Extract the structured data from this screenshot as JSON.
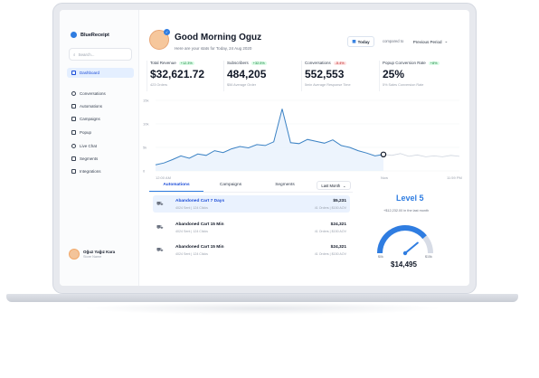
{
  "sidebar": {
    "brand": "BlueReceipt",
    "search_placeholder": "Search...",
    "items": [
      {
        "label": "Dashboard",
        "active": true
      },
      {
        "label": "Conversations"
      },
      {
        "label": "Automations"
      },
      {
        "label": "Campaigns"
      },
      {
        "label": "Popup"
      },
      {
        "label": "Live Chat"
      },
      {
        "label": "Segments"
      },
      {
        "label": "Integrations"
      }
    ],
    "user": {
      "name": "Oğuz Yağız Kara",
      "role": "Store Name"
    }
  },
  "header": {
    "greeting": "Good Morning Oguz",
    "subtitle": "Here are your stats for Today, 24 Aug 2020",
    "date_button": "Today",
    "compared_label": "compared to",
    "period_button": "Previous Period"
  },
  "stats": [
    {
      "label": "Total Revenue",
      "change": "+12.3%",
      "direction": "up",
      "value": "$32,621.72",
      "sub": "423 Orders"
    },
    {
      "label": "Subscribers",
      "change": "+32.5%",
      "direction": "up",
      "value": "484,205",
      "sub": "$56 Average Order"
    },
    {
      "label": "Conversations",
      "change": "-5.4%",
      "direction": "down",
      "value": "552,553",
      "sub": "5min Average Response Time"
    },
    {
      "label": "Popup Conversion Rate",
      "change": "+8%",
      "direction": "up",
      "value": "25%",
      "sub": "5% Sales Conversion Rate"
    }
  ],
  "chart_data": {
    "type": "line",
    "y_ticks": [
      "15k",
      "10k",
      "5k",
      "0"
    ],
    "ylim": [
      0,
      15000
    ],
    "x_labels": [
      "12:00 AM",
      "Now",
      "11:59 PM"
    ],
    "series": [
      {
        "style": "solid",
        "values": [
          1300,
          1700,
          2400,
          3200,
          2700,
          3600,
          3300,
          4300,
          3900,
          4700,
          5200,
          4900,
          5600,
          5400,
          6200,
          13200,
          6000,
          5800,
          6700,
          6300,
          5900,
          6600,
          5400,
          5000,
          4300,
          3800,
          3200,
          3500
        ]
      },
      {
        "style": "dashed",
        "values": [
          3500,
          3300,
          3700,
          3100,
          3400,
          3000,
          3200,
          3000,
          3300,
          3100
        ]
      }
    ]
  },
  "table": {
    "tabs": [
      "Automations",
      "Campaigns",
      "Segments"
    ],
    "filter": "Last Month",
    "rows": [
      {
        "title": "Abandoned Cart 7 Days",
        "sub": "4024 Sent | 124 Clicks",
        "value": "$5,231",
        "sub2": "41 Orders | $150 AOV",
        "highlight": true
      },
      {
        "title": "Abandoned Cart 15 Min",
        "sub": "4024 Sent | 124 Clicks",
        "value": "$24,321",
        "sub2": "41 Orders | $150 AOV"
      },
      {
        "title": "Abandoned Cart 15 Min",
        "sub": "4024 Sent | 124 Clicks",
        "value": "$24,321",
        "sub2": "41 Orders | $150 AOV"
      }
    ]
  },
  "level": {
    "title": "Level 5",
    "subtitle": "+$12,232.00 in the last month",
    "min": "$0k",
    "max": "$15k",
    "value": "$14,495",
    "progress": 0.78
  },
  "colors": {
    "accent": "#2f7de1",
    "accent_light": "#eaf2fe",
    "gauge_track": "#d7dce6"
  }
}
